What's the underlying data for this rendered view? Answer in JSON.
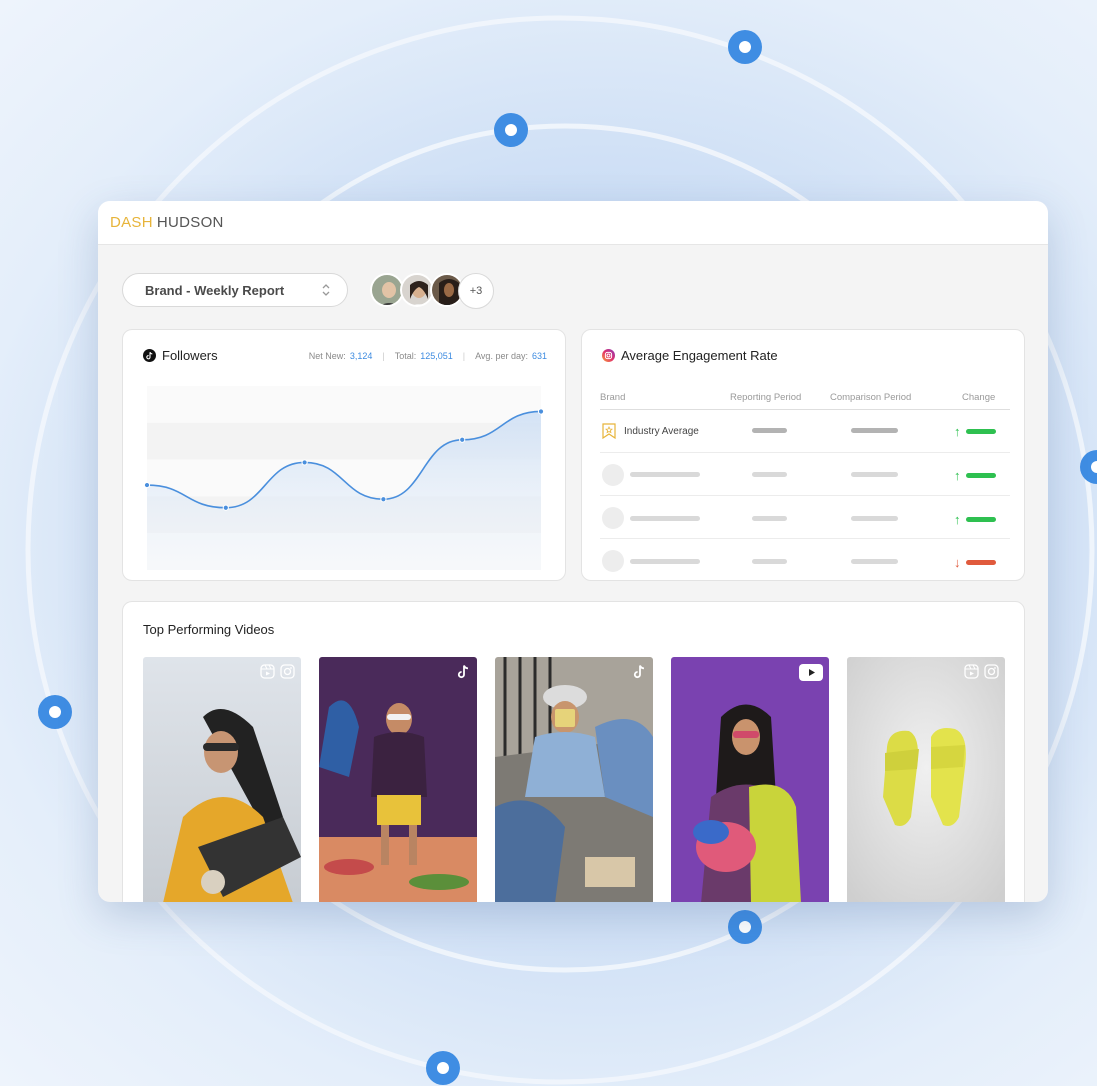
{
  "app": {
    "brand_part1": "DASH",
    "brand_part2": "HUDSON"
  },
  "colors": {
    "accent_blue": "#3d8be0",
    "brand_gold": "#e7b43a",
    "up_green": "#2ec050",
    "down_red": "#e05a3c"
  },
  "report_select": {
    "value": "Brand - Weekly Report",
    "icon": "chevron-updown-icon"
  },
  "collaborators": {
    "more_label": "+3"
  },
  "followers": {
    "title": "Followers",
    "icon": "tiktok-icon",
    "net_new_label": "Net New:",
    "net_new_value": "3,124",
    "total_label": "Total:",
    "total_value": "125,051",
    "avg_label": "Avg. per day:",
    "avg_value": "631"
  },
  "chart_data": {
    "type": "area",
    "title": "",
    "xlabel": "",
    "ylabel": "",
    "series": [
      {
        "values": [
          60,
          44,
          76,
          50,
          92,
          112
        ]
      }
    ],
    "ylim": [
      0,
      130
    ],
    "grid": true
  },
  "engagement": {
    "title": "Average Engagement Rate",
    "icon": "instagram-icon",
    "columns": [
      "Brand",
      "Reporting Period",
      "Comparison Period",
      "Change"
    ],
    "rows": [
      {
        "brand": "Industry Average",
        "icon": "ribbon-icon",
        "change": "up"
      },
      {
        "brand": "",
        "change": "up"
      },
      {
        "brand": "",
        "change": "up"
      },
      {
        "brand": "",
        "change": "down"
      }
    ]
  },
  "videos": {
    "title": "Top Performing Videos",
    "items": [
      {
        "platforms": [
          "reels-icon",
          "instagram-icon"
        ]
      },
      {
        "platforms": [
          "tiktok-icon"
        ]
      },
      {
        "platforms": [
          "tiktok-icon"
        ]
      },
      {
        "platforms": [
          "youtube-icon"
        ]
      },
      {
        "platforms": [
          "reels-icon",
          "instagram-icon"
        ]
      }
    ]
  }
}
